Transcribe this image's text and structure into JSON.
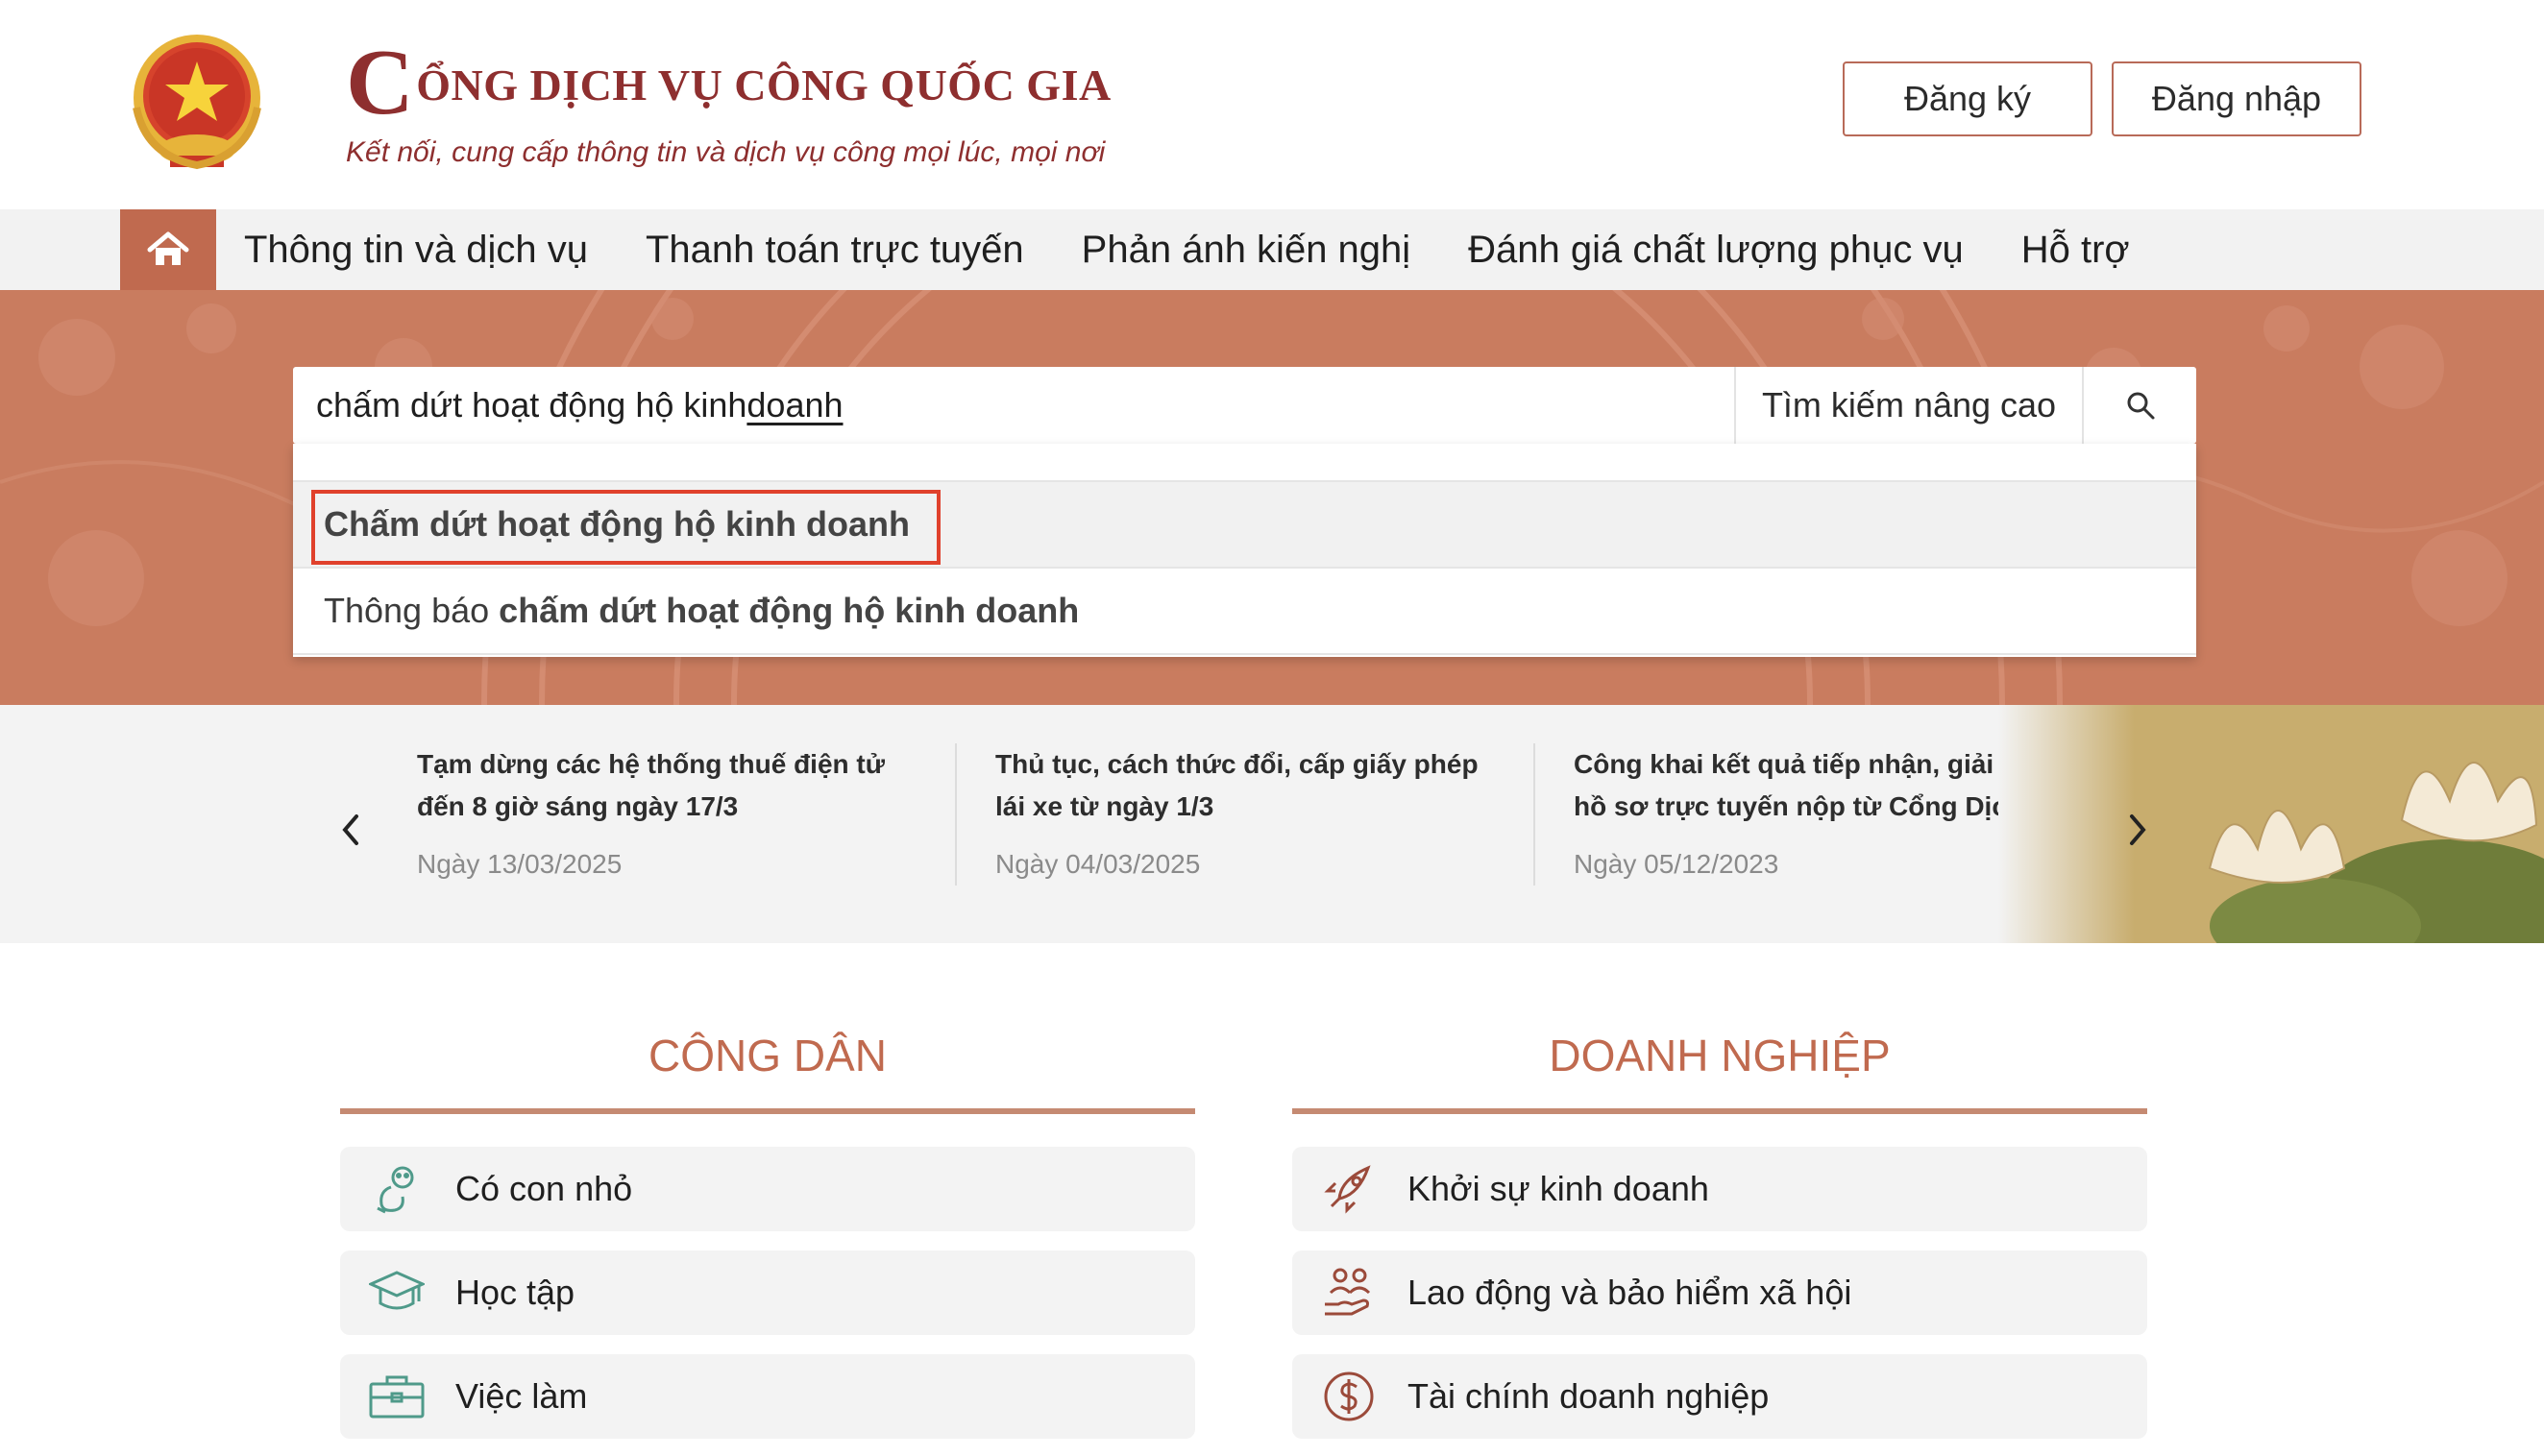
{
  "header": {
    "title_initial": "C",
    "title_rest": "ỔNG DỊCH VỤ CÔNG QUỐC GIA",
    "slogan": "Kết nối, cung cấp thông tin và dịch vụ công mọi lúc, mọi nơi",
    "register_label": "Đăng ký",
    "login_label": "Đăng nhập"
  },
  "nav": {
    "items": [
      {
        "label": "Thông tin và dịch vụ"
      },
      {
        "label": "Thanh toán trực tuyến"
      },
      {
        "label": "Phản ánh kiến nghị"
      },
      {
        "label": "Đánh giá chất lượng phục vụ"
      },
      {
        "label": "Hỗ trợ"
      }
    ]
  },
  "search": {
    "value_prefix": "chấm dứt hoạt động hộ kinh ",
    "value_underlined": "doanh",
    "advanced_label": "Tìm kiếm nâng cao",
    "suggestions": [
      {
        "prefix": "",
        "bold": "Chấm dứt hoạt động hộ kinh doanh"
      },
      {
        "prefix": "Thông báo ",
        "bold": "chấm dứt hoạt động hộ kinh doanh"
      }
    ]
  },
  "news": [
    {
      "title": "Tạm dừng các hệ thống thuế điện tử đến 8 giờ sáng ngày 17/3",
      "date": "Ngày 13/03/2025"
    },
    {
      "title": "Thủ tục, cách thức đổi, cấp giấy phép lái xe từ ngày 1/3",
      "date": "Ngày 04/03/2025"
    },
    {
      "title": "Công khai kết quả tiếp nhận, giải quyết hồ sơ trực tuyến nộp từ Cổng Dịch vụ...",
      "date": "Ngày 05/12/2023"
    }
  ],
  "citizen": {
    "title": "CÔNG DÂN",
    "items": [
      {
        "label": "Có con nhỏ",
        "icon": "baby-icon"
      },
      {
        "label": "Học tập",
        "icon": "graduation-cap-icon"
      },
      {
        "label": "Việc làm",
        "icon": "briefcase-icon"
      }
    ]
  },
  "business": {
    "title": "DOANH NGHIỆP",
    "items": [
      {
        "label": "Khởi sự kinh doanh",
        "icon": "rocket-icon"
      },
      {
        "label": "Lao động và bảo hiểm xã hội",
        "icon": "people-hand-icon"
      },
      {
        "label": "Tài chính doanh nghiệp",
        "icon": "dollar-coin-icon"
      }
    ]
  },
  "colors": {
    "brand": "#8e2f2f",
    "accent": "#c06a4f",
    "highlight": "#e0412c",
    "icon_teal": "#4f9a8a",
    "icon_brown": "#9b4a3a"
  }
}
